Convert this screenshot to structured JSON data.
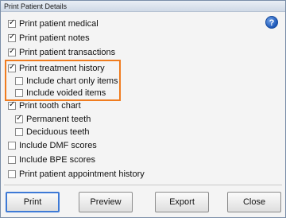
{
  "window": {
    "title": "Print Patient Details"
  },
  "options": [
    {
      "label": "Print patient medical",
      "checked": true
    },
    {
      "label": "Print patient notes",
      "checked": true
    },
    {
      "label": "Print patient transactions",
      "checked": true
    },
    {
      "label": "Print treatment history",
      "checked": true
    },
    {
      "label": "Include chart only items",
      "checked": false
    },
    {
      "label": "Include voided items",
      "checked": false
    },
    {
      "label": "Print tooth chart",
      "checked": true
    },
    {
      "label": "Permanent teeth",
      "checked": true
    },
    {
      "label": "Deciduous teeth",
      "checked": false
    },
    {
      "label": "Include DMF scores",
      "checked": false
    },
    {
      "label": "Include BPE scores",
      "checked": false
    },
    {
      "label": "Print patient appointment history",
      "checked": false
    }
  ],
  "help_icon": {
    "glyph": "?"
  },
  "buttons": {
    "print": "Print",
    "preview": "Preview",
    "export": "Export",
    "close": "Close"
  },
  "colors": {
    "highlight": "#f07c1f",
    "accent": "#3e7ad6"
  }
}
